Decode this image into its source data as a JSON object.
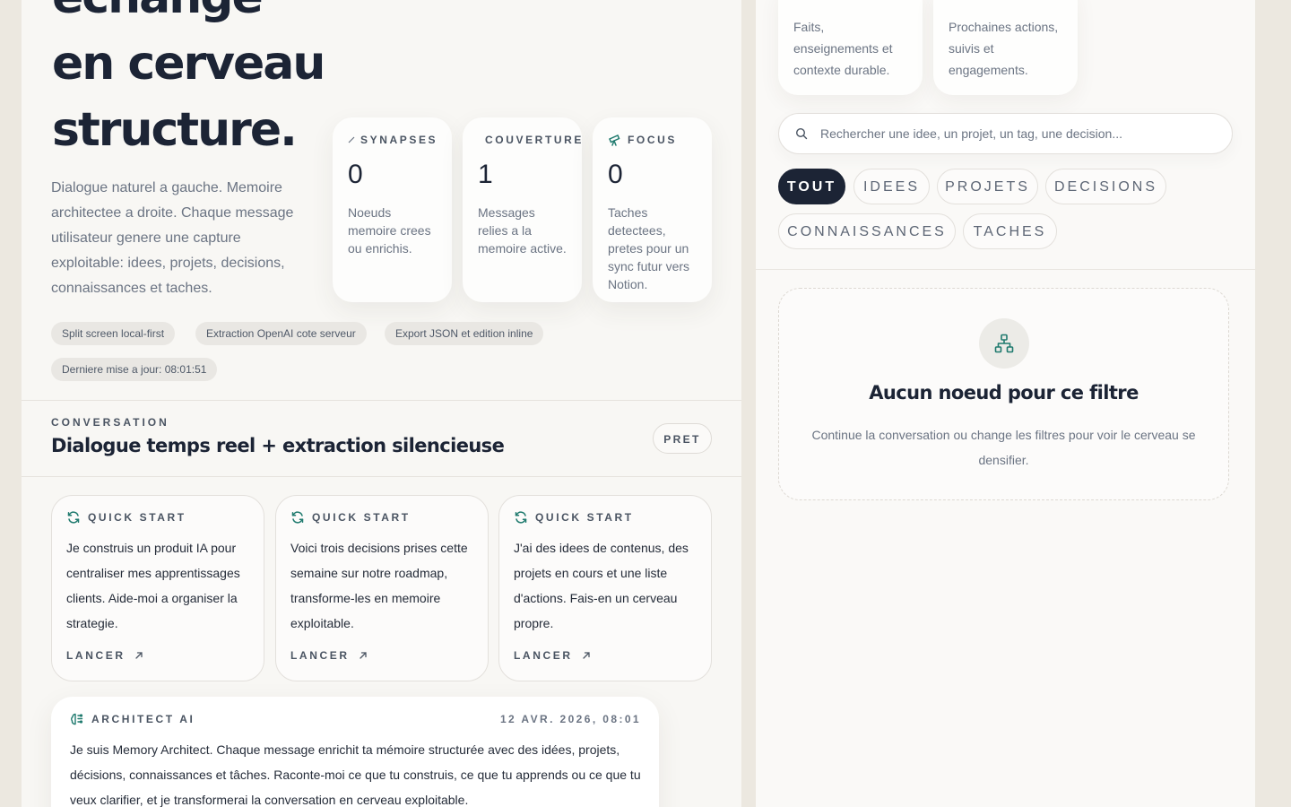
{
  "hero": {
    "title_lines": [
      "echange",
      "en cerveau",
      "structure."
    ],
    "description": "Dialogue naturel a gauche. Memoire architectee a droite. Chaque message utilisateur genere une capture exploitable: idees, projets, decisions, connaissances et taches."
  },
  "stats": [
    {
      "label": "SYNAPSES",
      "icon": "spark-icon",
      "value": "0",
      "desc": "Noeuds memoire crees ou enrichis."
    },
    {
      "label": "COUVERTURE",
      "icon": "",
      "value": "1",
      "desc": "Messages relies a la memoire active."
    },
    {
      "label": "FOCUS",
      "icon": "telescope-icon",
      "value": "0",
      "desc": "Taches detectees, pretes pour un sync futur vers Notion."
    }
  ],
  "pills": [
    "Split screen local-first",
    "Extraction OpenAI cote serveur",
    "Export JSON et edition inline",
    "Derniere mise a jour: 08:01:51"
  ],
  "conversation": {
    "kicker": "CONVERSATION",
    "title": "Dialogue temps reel + extraction silencieuse",
    "status": "PRET"
  },
  "quick_starts": [
    {
      "head": "QUICK START",
      "text": "Je construis un produit IA pour centraliser mes apprentissages clients. Aide-moi a organiser la strategie.",
      "action": "LANCER"
    },
    {
      "head": "QUICK START",
      "text": "Voici trois decisions prises cette semaine sur notre roadmap, transforme-les en memoire exploitable.",
      "action": "LANCER"
    },
    {
      "head": "QUICK START",
      "text": "J'ai des idees de contenus, des projets en cours et une liste d'actions. Fais-en un cerveau propre.",
      "action": "LANCER"
    }
  ],
  "ai_message": {
    "sender": "ARCHITECT AI",
    "timestamp": "12 AVR. 2026, 08:01",
    "text": "Je suis Memory Architect. Chaque message enrichit ta mémoire structurée avec des idées, projets, décisions, connaissances et tâches. Raconte-moi ce que tu construis, ce que tu apprends ou ce que tu veux clarifier, et je transformerai la conversation en cerveau exploitable."
  },
  "right": {
    "top_cards": [
      {
        "text": "Faits, enseignements et contexte durable."
      },
      {
        "text": "Prochaines actions, suivis et engagements."
      }
    ],
    "search": {
      "placeholder": "Rechercher une idee, un projet, un tag, une decision..."
    },
    "filters": [
      {
        "label": "TOUT",
        "active": true
      },
      {
        "label": "IDEES",
        "active": false
      },
      {
        "label": "PROJETS",
        "active": false
      },
      {
        "label": "DECISIONS",
        "active": false
      },
      {
        "label": "CONNAISSANCES",
        "active": false
      },
      {
        "label": "TACHES",
        "active": false
      }
    ],
    "empty": {
      "icon": "hierarchy-icon",
      "title": "Aucun noeud pour ce filtre",
      "desc": "Continue la conversation ou change les filtres pour voir le cerveau se densifier."
    }
  },
  "colors": {
    "accent": "#1f7a6e",
    "ink": "#1c2435",
    "muted": "#6b7483"
  }
}
